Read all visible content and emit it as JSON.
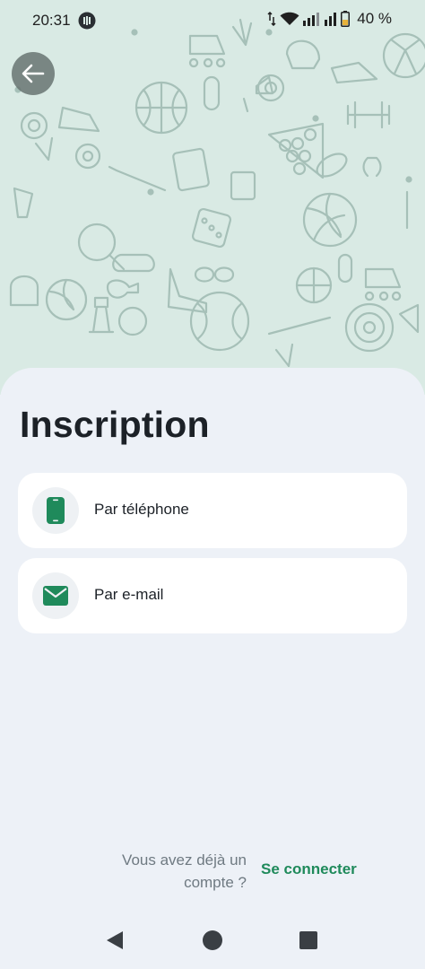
{
  "status_bar": {
    "time": "20:31",
    "battery": "40 %"
  },
  "header": {
    "back_icon": "arrow-left-icon"
  },
  "signup": {
    "title": "Inscription",
    "options": [
      {
        "label": "Par téléphone",
        "icon": "smartphone-icon"
      },
      {
        "label": "Par e-mail",
        "icon": "mail-icon"
      }
    ],
    "footer_question": "Vous avez déjà un compte ?",
    "footer_link": "Se connecter"
  },
  "colors": {
    "accent": "#1f8a5b",
    "pattern_background": "#d9eae4",
    "sheet_background": "#edf1f7"
  }
}
